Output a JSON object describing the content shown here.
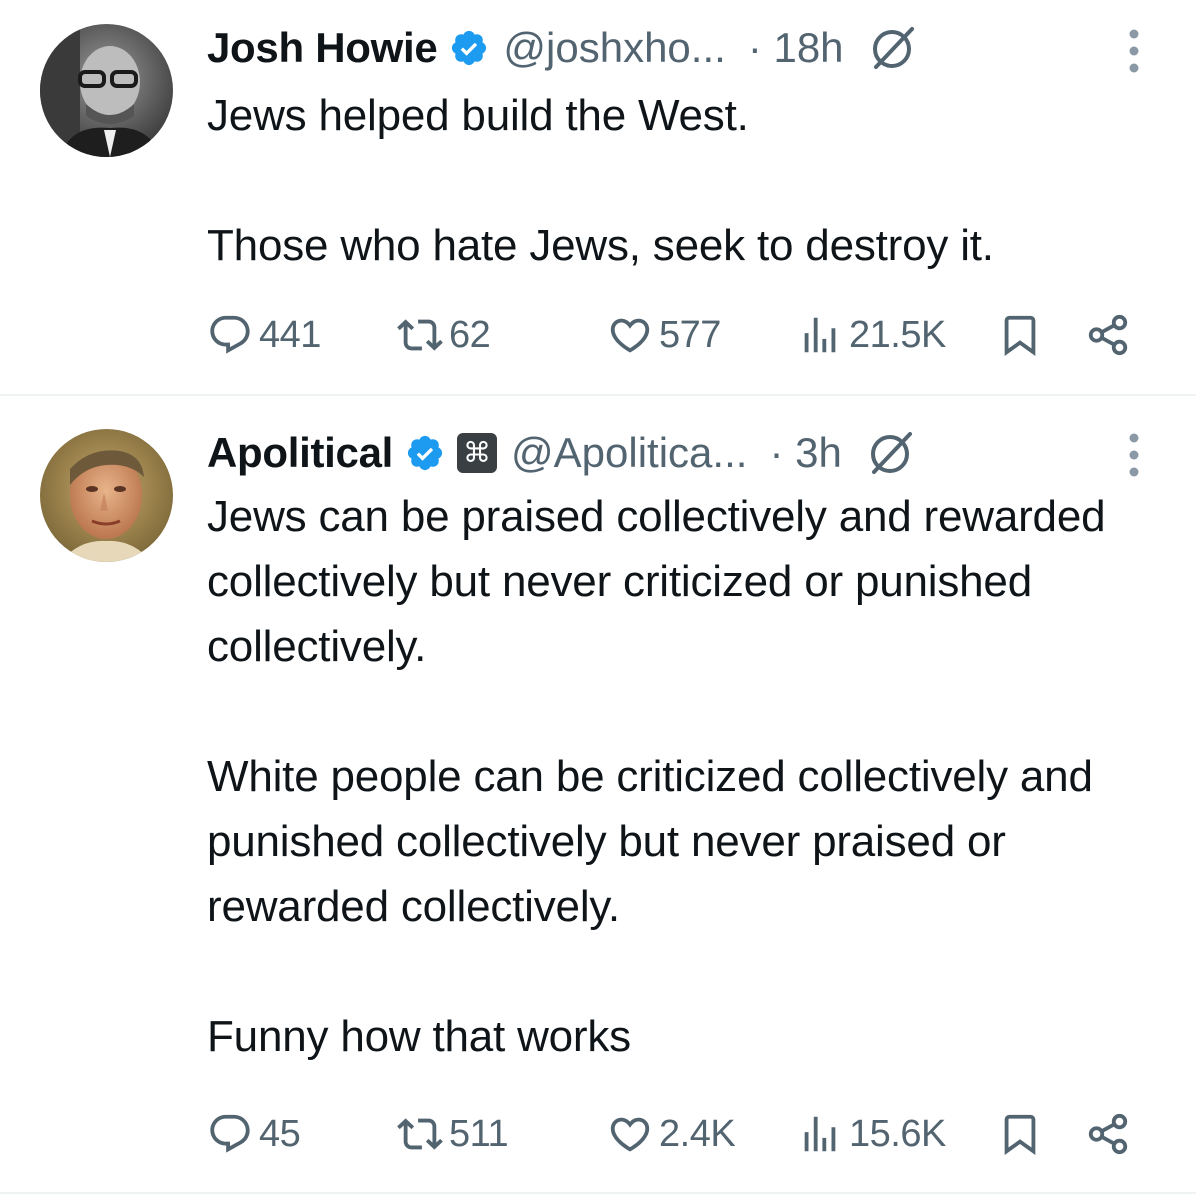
{
  "tweets": [
    {
      "author": {
        "name": "Josh Howie",
        "handle": "@joshxho...",
        "verified": true
      },
      "time": "· 18h",
      "text": "Jews helped build the West.\n\nThose who hate Jews, seek to destroy it.",
      "stats": {
        "replies": "441",
        "reposts": "62",
        "likes": "577",
        "views": "21.5K"
      }
    },
    {
      "author": {
        "name": "Apolitical",
        "handle": "@Apolitica...",
        "verified": true,
        "affiliation_badge": "⌘"
      },
      "time": "· 3h",
      "text": "Jews can be praised collectively and rewarded collectively but never criticized or punished collectively.\n\nWhite people can be criticized collectively and punished collectively but never praised or rewarded collectively.\n\nFunny how that works",
      "stats": {
        "replies": "45",
        "reposts": "511",
        "likes": "2.4K",
        "views": "15.6K"
      }
    }
  ],
  "colors": {
    "text_primary": "#0f1419",
    "text_secondary": "#536471",
    "verified_blue": "#1d9bf0",
    "divider": "#eff3f4"
  },
  "icons": [
    "reply-icon",
    "repost-icon",
    "like-icon",
    "views-icon",
    "bookmark-icon",
    "share-icon",
    "grok-icon",
    "more-icon",
    "verified-badge-icon"
  ]
}
